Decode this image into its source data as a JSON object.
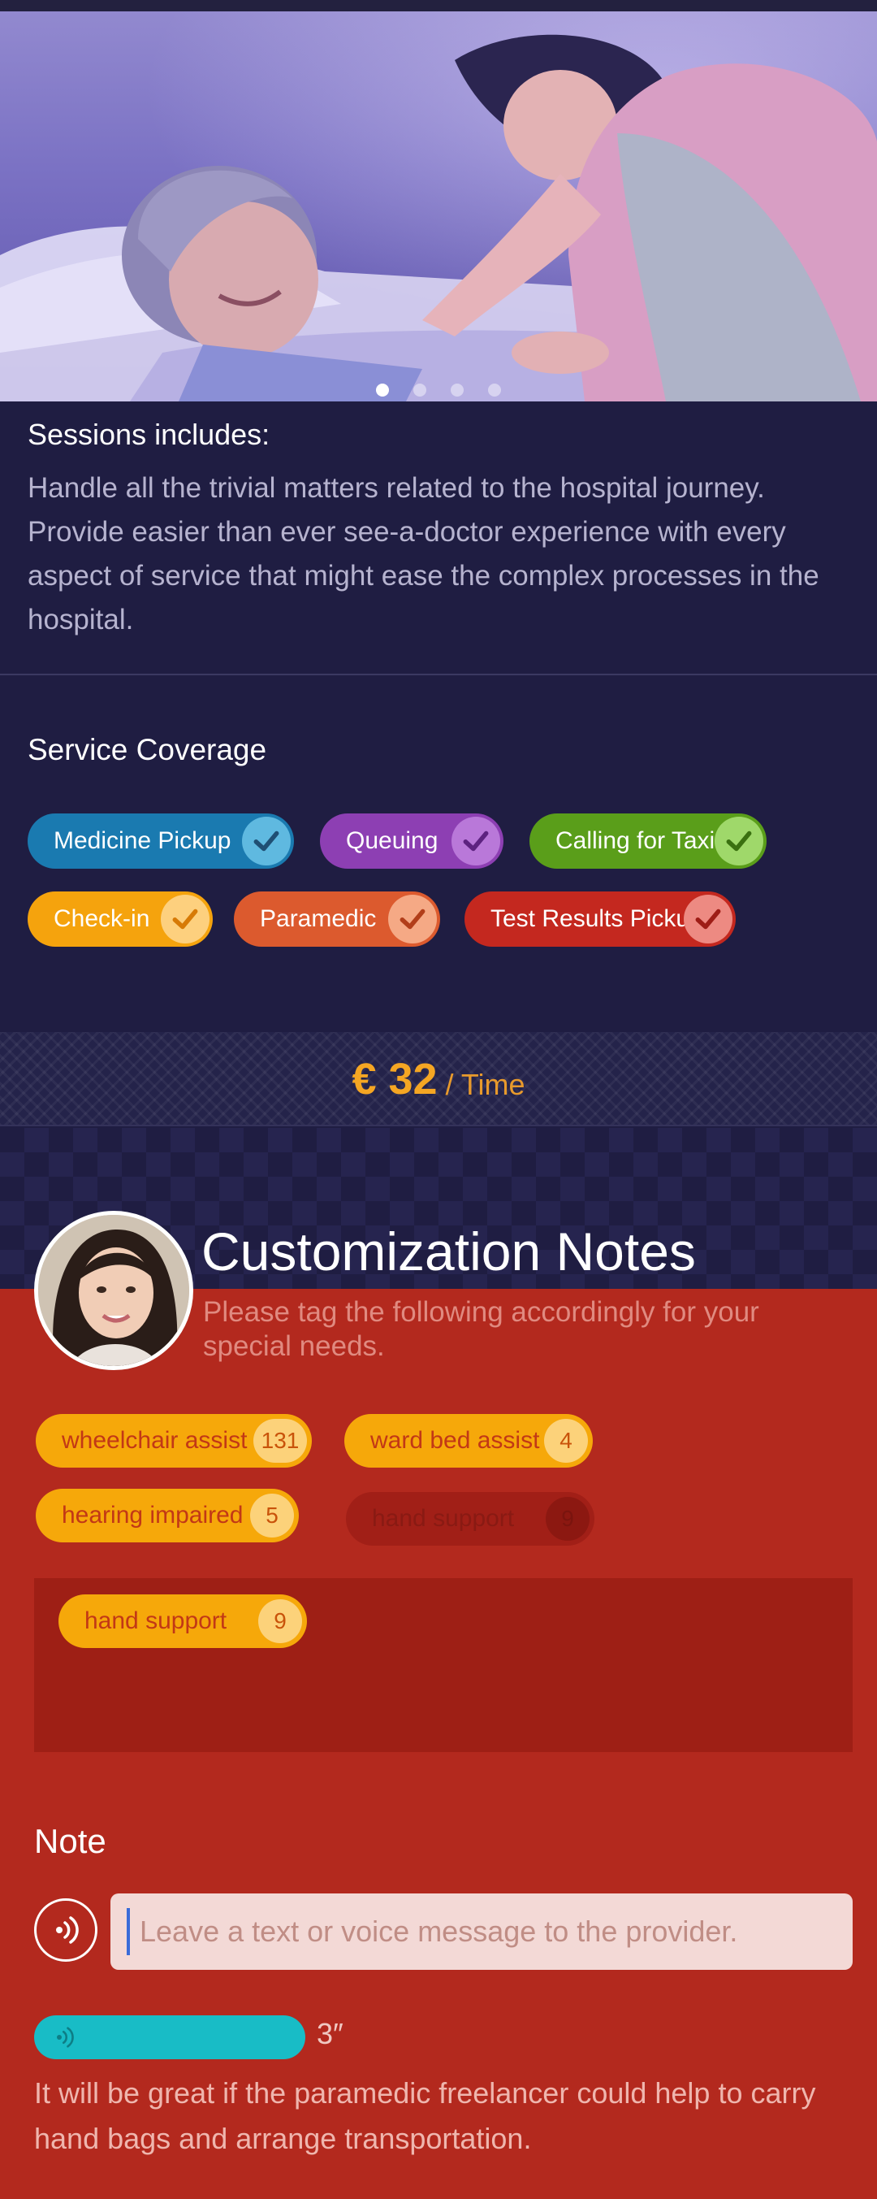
{
  "carousel": {
    "total_slides": 4,
    "active_index": 0
  },
  "session": {
    "title": "Sessions includes:",
    "description": "Handle all the trivial matters related to the hospital journey. Provide easier than ever see-a-doctor experience with every aspect of service that might ease the complex processes in the hospital."
  },
  "coverage": {
    "title": "Service Coverage",
    "items": [
      {
        "label": "Medicine Pickup",
        "color": "#1a7ab0",
        "check_color": "#5fb9e0"
      },
      {
        "label": "Queuing",
        "color": "#8d3fb3",
        "check_color": "#b978d9"
      },
      {
        "label": "Calling for Taxi",
        "color": "#5a9e1a",
        "check_color": "#9fd86a"
      },
      {
        "label": "Check-in",
        "color": "#f5a30d",
        "check_color": "#fdd07e"
      },
      {
        "label": "Paramedic",
        "color": "#dc5a2e",
        "check_color": "#f5a985"
      },
      {
        "label": "Test Results Pickup",
        "color": "#c4281f",
        "check_color": "#ed8a82"
      }
    ]
  },
  "price": {
    "amount": "€ 32",
    "unit": "/ Time",
    "color": "#f5a623"
  },
  "customization": {
    "title": "Customization Notes",
    "subtitle": "Please tag the following accordingly for your special needs.",
    "tags": [
      {
        "label": "wheelchair assist",
        "count": "131"
      },
      {
        "label": "ward bed assist",
        "count": "4"
      },
      {
        "label": "hearing impaired",
        "count": "5"
      },
      {
        "label": "hand support",
        "count": "9"
      }
    ],
    "selected_tag": {
      "label": "hand support",
      "count": "9"
    }
  },
  "note": {
    "title": "Note",
    "placeholder": "Leave a text or voice message to the provider.",
    "voice_duration": "3″",
    "text": "It will be great if the paramedic freelancer could help to carry hand bags and arrange transportation."
  },
  "icons": {
    "check": "checkmark-icon",
    "voice": "voice-wave-icon"
  }
}
